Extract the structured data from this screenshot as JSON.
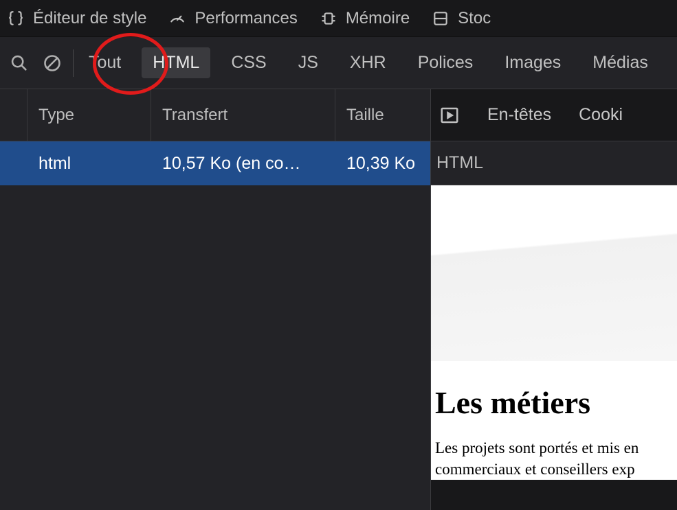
{
  "topTabs": {
    "style": "Éditeur de style",
    "perf": "Performances",
    "memory": "Mémoire",
    "storage": "Stoc"
  },
  "filters": {
    "all": "Tout",
    "html": "HTML",
    "css": "CSS",
    "js": "JS",
    "xhr": "XHR",
    "fonts": "Polices",
    "images": "Images",
    "media": "Médias"
  },
  "table": {
    "headers": {
      "type": "Type",
      "transfer": "Transfert",
      "size": "Taille"
    },
    "rows": [
      {
        "type": "html",
        "transfer": "10,57 Ko (en co…",
        "size": "10,39 Ko"
      }
    ]
  },
  "detail": {
    "tabs": {
      "headers": "En-têtes",
      "cookies": "Cooki"
    },
    "title": "HTML"
  },
  "preview": {
    "heading": "Les métiers",
    "paragraph": "Les projets sont portés et mis en commerciaux et conseillers exp"
  }
}
